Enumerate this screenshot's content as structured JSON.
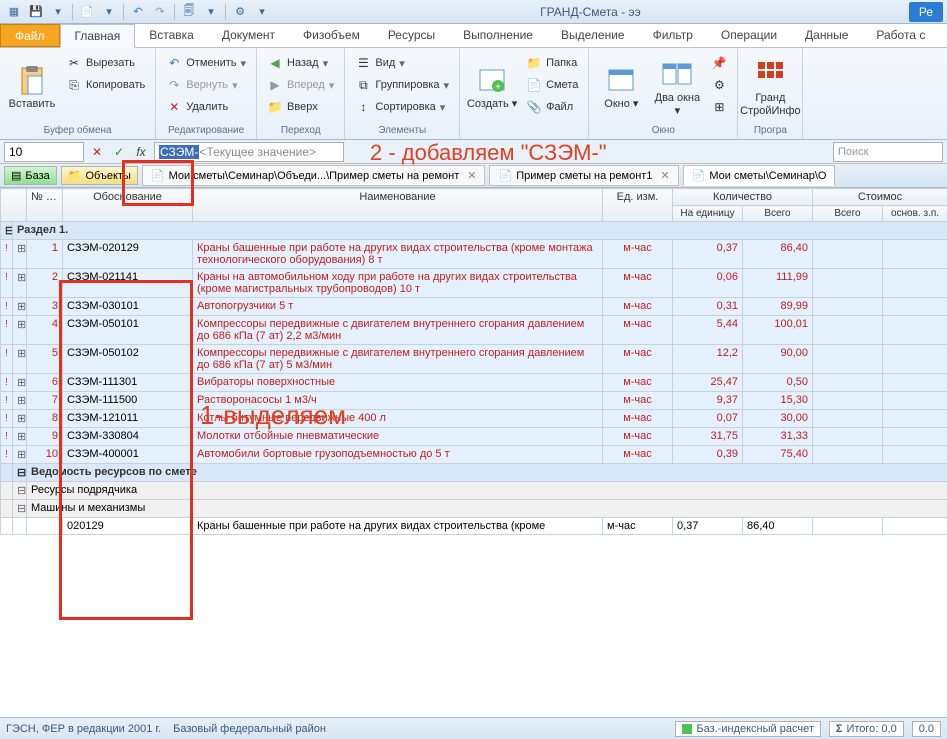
{
  "app_title": "ГРАНД-Смета - ээ",
  "new_label": "Ре",
  "tabs": {
    "file": "Файл",
    "items": [
      "Главная",
      "Вставка",
      "Документ",
      "Физобъем",
      "Ресурсы",
      "Выполнение",
      "Выделение",
      "Фильтр",
      "Операции",
      "Данные",
      "Работа с"
    ]
  },
  "ribbon": {
    "paste": "Вставить",
    "cut": "Вырезать",
    "copy": "Копировать",
    "clipboard_label": "Буфер обмена",
    "undo": "Отменить",
    "redo": "Вернуть",
    "delete": "Удалить",
    "edit_label": "Редактирование",
    "back": "Назад",
    "forward": "Вперед",
    "up": "Вверх",
    "nav_label": "Переход",
    "view": "Вид",
    "group": "Группировка",
    "sort": "Сортировка",
    "elements_label": "Элементы",
    "create": "Создать",
    "folder": "Папка",
    "smeta": "Смета",
    "file_item": "Файл",
    "window": "Окно",
    "two_windows": "Два окна",
    "window_label": "Окно",
    "grand_info": "Гранд СтройИнфо",
    "prog_label": "Програ"
  },
  "formula": {
    "name_box": "10",
    "prefix": "СЗЭМ-",
    "placeholder": "<Текущее значение>",
    "search_placeholder": "Поиск"
  },
  "annotations": {
    "a1": "2 - добавляем \"СЗЭМ-\"",
    "a2": "1-выделяем"
  },
  "sheet_tabs": {
    "base": "База",
    "objects": "Объекты",
    "t1": "Мои сметы\\Семинар\\Объеди...\\Пример сметы на ремонт",
    "t2": "Пример сметы на ремонт1",
    "t3": "Мои сметы\\Семинар\\О"
  },
  "headers": {
    "npp": "№ п.п",
    "osn": "Обоснование",
    "name": "Наименование",
    "unit": "Ед. изм.",
    "qty": "Количество",
    "qty_unit": "На единицу",
    "qty_total": "Всего",
    "cost": "Стоимос",
    "cost_sub": "Всего",
    "cost_sub2": "основ. з.п."
  },
  "section1": "Раздел 1.",
  "rows": [
    {
      "n": "1",
      "code": "СЗЭМ-020129",
      "name": "Краны башенные при работе на других видах строительства (кроме монтажа технологического оборудования) 8 т",
      "unit": "м-час",
      "q1": "0,37",
      "q2": "86,40"
    },
    {
      "n": "2",
      "code": "СЗЭМ-021141",
      "name": "Краны на автомобильном ходу при работе на других видах строительства (кроме магистральных трубопроводов) 10 т",
      "unit": "м-час",
      "q1": "0,06",
      "q2": "111,99"
    },
    {
      "n": "3",
      "code": "СЗЭМ-030101",
      "name": "Автопогрузчики 5 т",
      "unit": "м-час",
      "q1": "0,31",
      "q2": "89,99"
    },
    {
      "n": "4",
      "code": "СЗЭМ-050101",
      "name": "Компрессоры передвижные с двигателем внутреннего сгорания давлением до 686 кПа (7 ат) 2,2 м3/мин",
      "unit": "м-час",
      "q1": "5,44",
      "q2": "100,01"
    },
    {
      "n": "5",
      "code": "СЗЭМ-050102",
      "name": "Компрессоры передвижные с двигателем внутреннего сгорания давлением до 686 кПа (7 ат) 5 м3/мин",
      "unit": "м-час",
      "q1": "12,2",
      "q2": "90,00"
    },
    {
      "n": "6",
      "code": "СЗЭМ-111301",
      "name": "Вибраторы поверхностные",
      "unit": "м-час",
      "q1": "25,47",
      "q2": "0,50"
    },
    {
      "n": "7",
      "code": "СЗЭМ-111500",
      "name": "Растворонасосы 1 м3/ч",
      "unit": "м-час",
      "q1": "9,37",
      "q2": "15,30"
    },
    {
      "n": "8",
      "code": "СЗЭМ-121011",
      "name": "Котлы битумные передвижные 400 л",
      "unit": "м-час",
      "q1": "0,07",
      "q2": "30,00"
    },
    {
      "n": "9",
      "code": "СЗЭМ-330804",
      "name": "Молотки отбойные пневматические",
      "unit": "м-час",
      "q1": "31,75",
      "q2": "31,33"
    },
    {
      "n": "10",
      "code": "СЗЭМ-400001",
      "name": "Автомобили бортовые грузоподъемностью до 5 т",
      "unit": "м-час",
      "q1": "0,39",
      "q2": "75,40"
    }
  ],
  "footer_sections": {
    "s1": "Ведомость ресурсов по смете",
    "s2": "Ресурсы подрядчика",
    "s3": "Машины и механизмы"
  },
  "res_row": {
    "code": "020129",
    "name": "Краны башенные при работе на других видах строительства (кроме",
    "unit": "м-час",
    "q1": "0,37",
    "q2": "86,40"
  },
  "status": {
    "left1": "ГЭСН, ФЕР в редакции 2001 г.",
    "left2": "Базовый федеральный район",
    "right1": "Баз.-индексный расчет",
    "right2": "Итого: 0,0",
    "right3": "0.0"
  }
}
